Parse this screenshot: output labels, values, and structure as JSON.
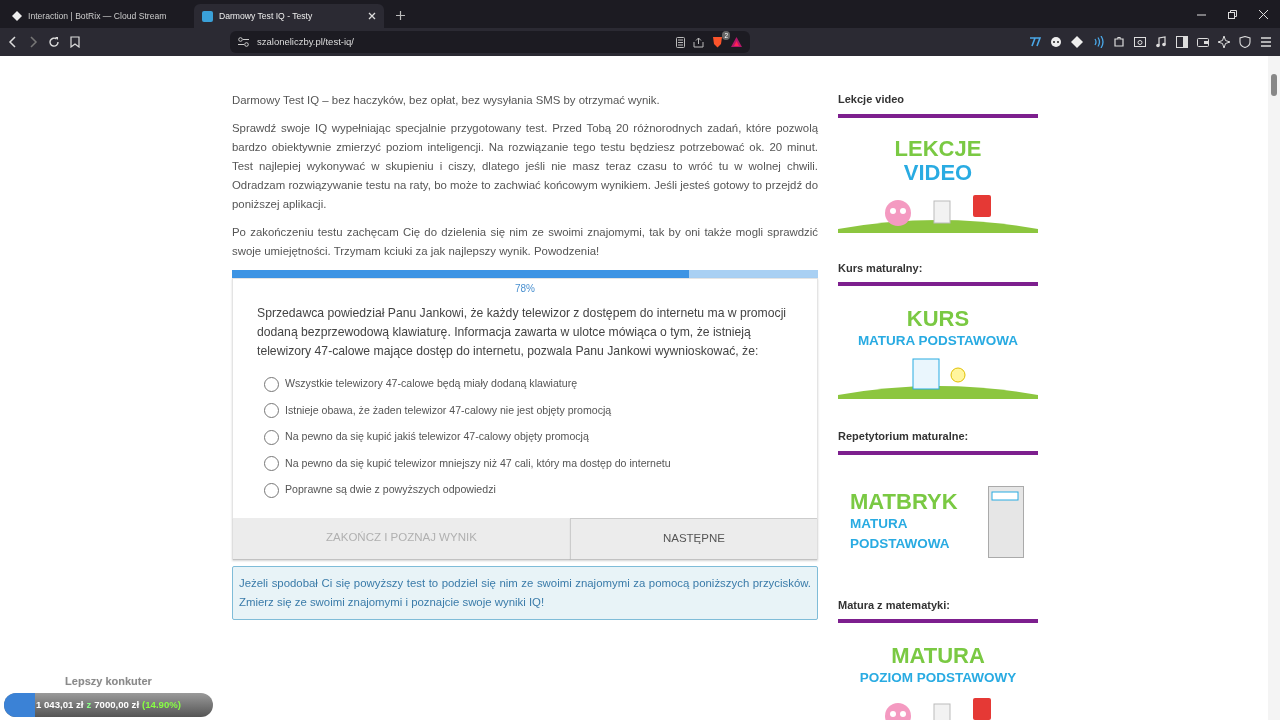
{
  "browser": {
    "tabs": [
      {
        "title": "Interaction | BotRix — Cloud Stream",
        "selected": false
      },
      {
        "title": "Darmowy Test IQ - Testy",
        "selected": true
      }
    ],
    "url": "szaloneliczby.pl/test-iq/",
    "shields_badge": "2"
  },
  "intro": [
    "Darmowy Test IQ – bez haczyków, bez opłat, bez wysyłania SMS by otrzymać wynik.",
    "Sprawdź swoje IQ wypełniając specjalnie przygotowany test. Przed Tobą 20 różnorodnych zadań, które pozwolą bardzo obiektywnie zmierzyć poziom inteligencji. Na rozwiązanie tego testu będziesz potrzebować ok. 20 minut. Test najlepiej wykonywać w skupieniu i ciszy, dlatego jeśli nie masz teraz czasu to wróć tu w wolnej chwili. Odradzam rozwiązywanie testu na raty, bo może to zachwiać końcowym wynikiem. Jeśli jesteś gotowy to przejdź do poniższej aplikacji.",
    "Po zakończeniu testu zachęcam Cię do dzielenia się nim ze swoimi znajomymi, tak by oni także mogli sprawdzić swoje umiejętności. Trzymam kciuki za jak najlepszy wynik. Powodzenia!"
  ],
  "quiz": {
    "progress": {
      "level": 0.78,
      "label": "78%"
    },
    "question": "Sprzedawca powiedział Panu Jankowi, że każdy telewizor z dostępem do internetu ma w promocji dodaną bezprzewodową klawiaturę. Informacja zawarta w ulotce mówiąca o tym, że istnieją telewizory 47-calowe mające dostęp do internetu, pozwala Panu Jankowi wywnioskować, że:",
    "options": [
      {
        "label": "Wszystkie telewizory 47-calowe będą miały dodaną klawiaturę",
        "selected": false
      },
      {
        "label": "Istnieje obawa, że żaden telewizor 47-calowy nie jest objęty promocją",
        "selected": false
      },
      {
        "label": "Na pewno da się kupić jakiś telewizor 47-calowy objęty promocją",
        "selected": false
      },
      {
        "label": "Na pewno da się kupić telewizor mniejszy niż 47 cali, który ma dostęp do internetu",
        "selected": false
      },
      {
        "label": "Poprawne są dwie z powyższych odpowiedzi",
        "selected": false
      }
    ],
    "buttons": [
      {
        "label": "ZAKOŃCZ I POZNAJ WYNIK",
        "disabled": true
      },
      {
        "label": "NASTĘPNE",
        "disabled": false
      }
    ]
  },
  "share_note": "Jeżeli spodobał Ci się powyższy test to podziel się nim ze swoimi znajomymi za pomocą poniższych przycisków. Zmierz się ze swoimi znajomymi i poznajcie swoje wyniki IQ!",
  "sidebar": [
    {
      "heading": "Lekcje video",
      "banner": {
        "kind": "brain",
        "lines": [
          {
            "text": "LEKCJE",
            "kind": "title"
          },
          {
            "text": "VIDEO",
            "kind": "subtitle-big"
          }
        ]
      }
    },
    {
      "heading": "Kurs maturalny:",
      "banner": {
        "kind": "document",
        "lines": [
          {
            "text": "KURS",
            "kind": "title"
          },
          {
            "text": "MATURA PODSTAWOWA",
            "kind": "subtitle"
          }
        ]
      }
    },
    {
      "heading": "Repetytorium maturalne:",
      "banner": {
        "kind": "book",
        "lines": [
          {
            "text": "MATBRYK",
            "kind": "title"
          },
          {
            "text": "MATURA",
            "kind": "subtitle"
          },
          {
            "text": "PODSTAWOWA",
            "kind": "subtitle"
          }
        ]
      }
    },
    {
      "heading": "Matura z matematyki:",
      "banner": {
        "kind": "brain",
        "lines": [
          {
            "text": "MATURA",
            "kind": "title"
          },
          {
            "text": "POZIOM PODSTAWOWY",
            "kind": "subtitle"
          }
        ]
      }
    }
  ],
  "stream_goal": {
    "caption": "Lepszy konkuter",
    "amount": "1 043,01 zł",
    "separator": "z",
    "target": "7000,00 zł",
    "percent": "(14.90%)",
    "level": 0.149
  }
}
